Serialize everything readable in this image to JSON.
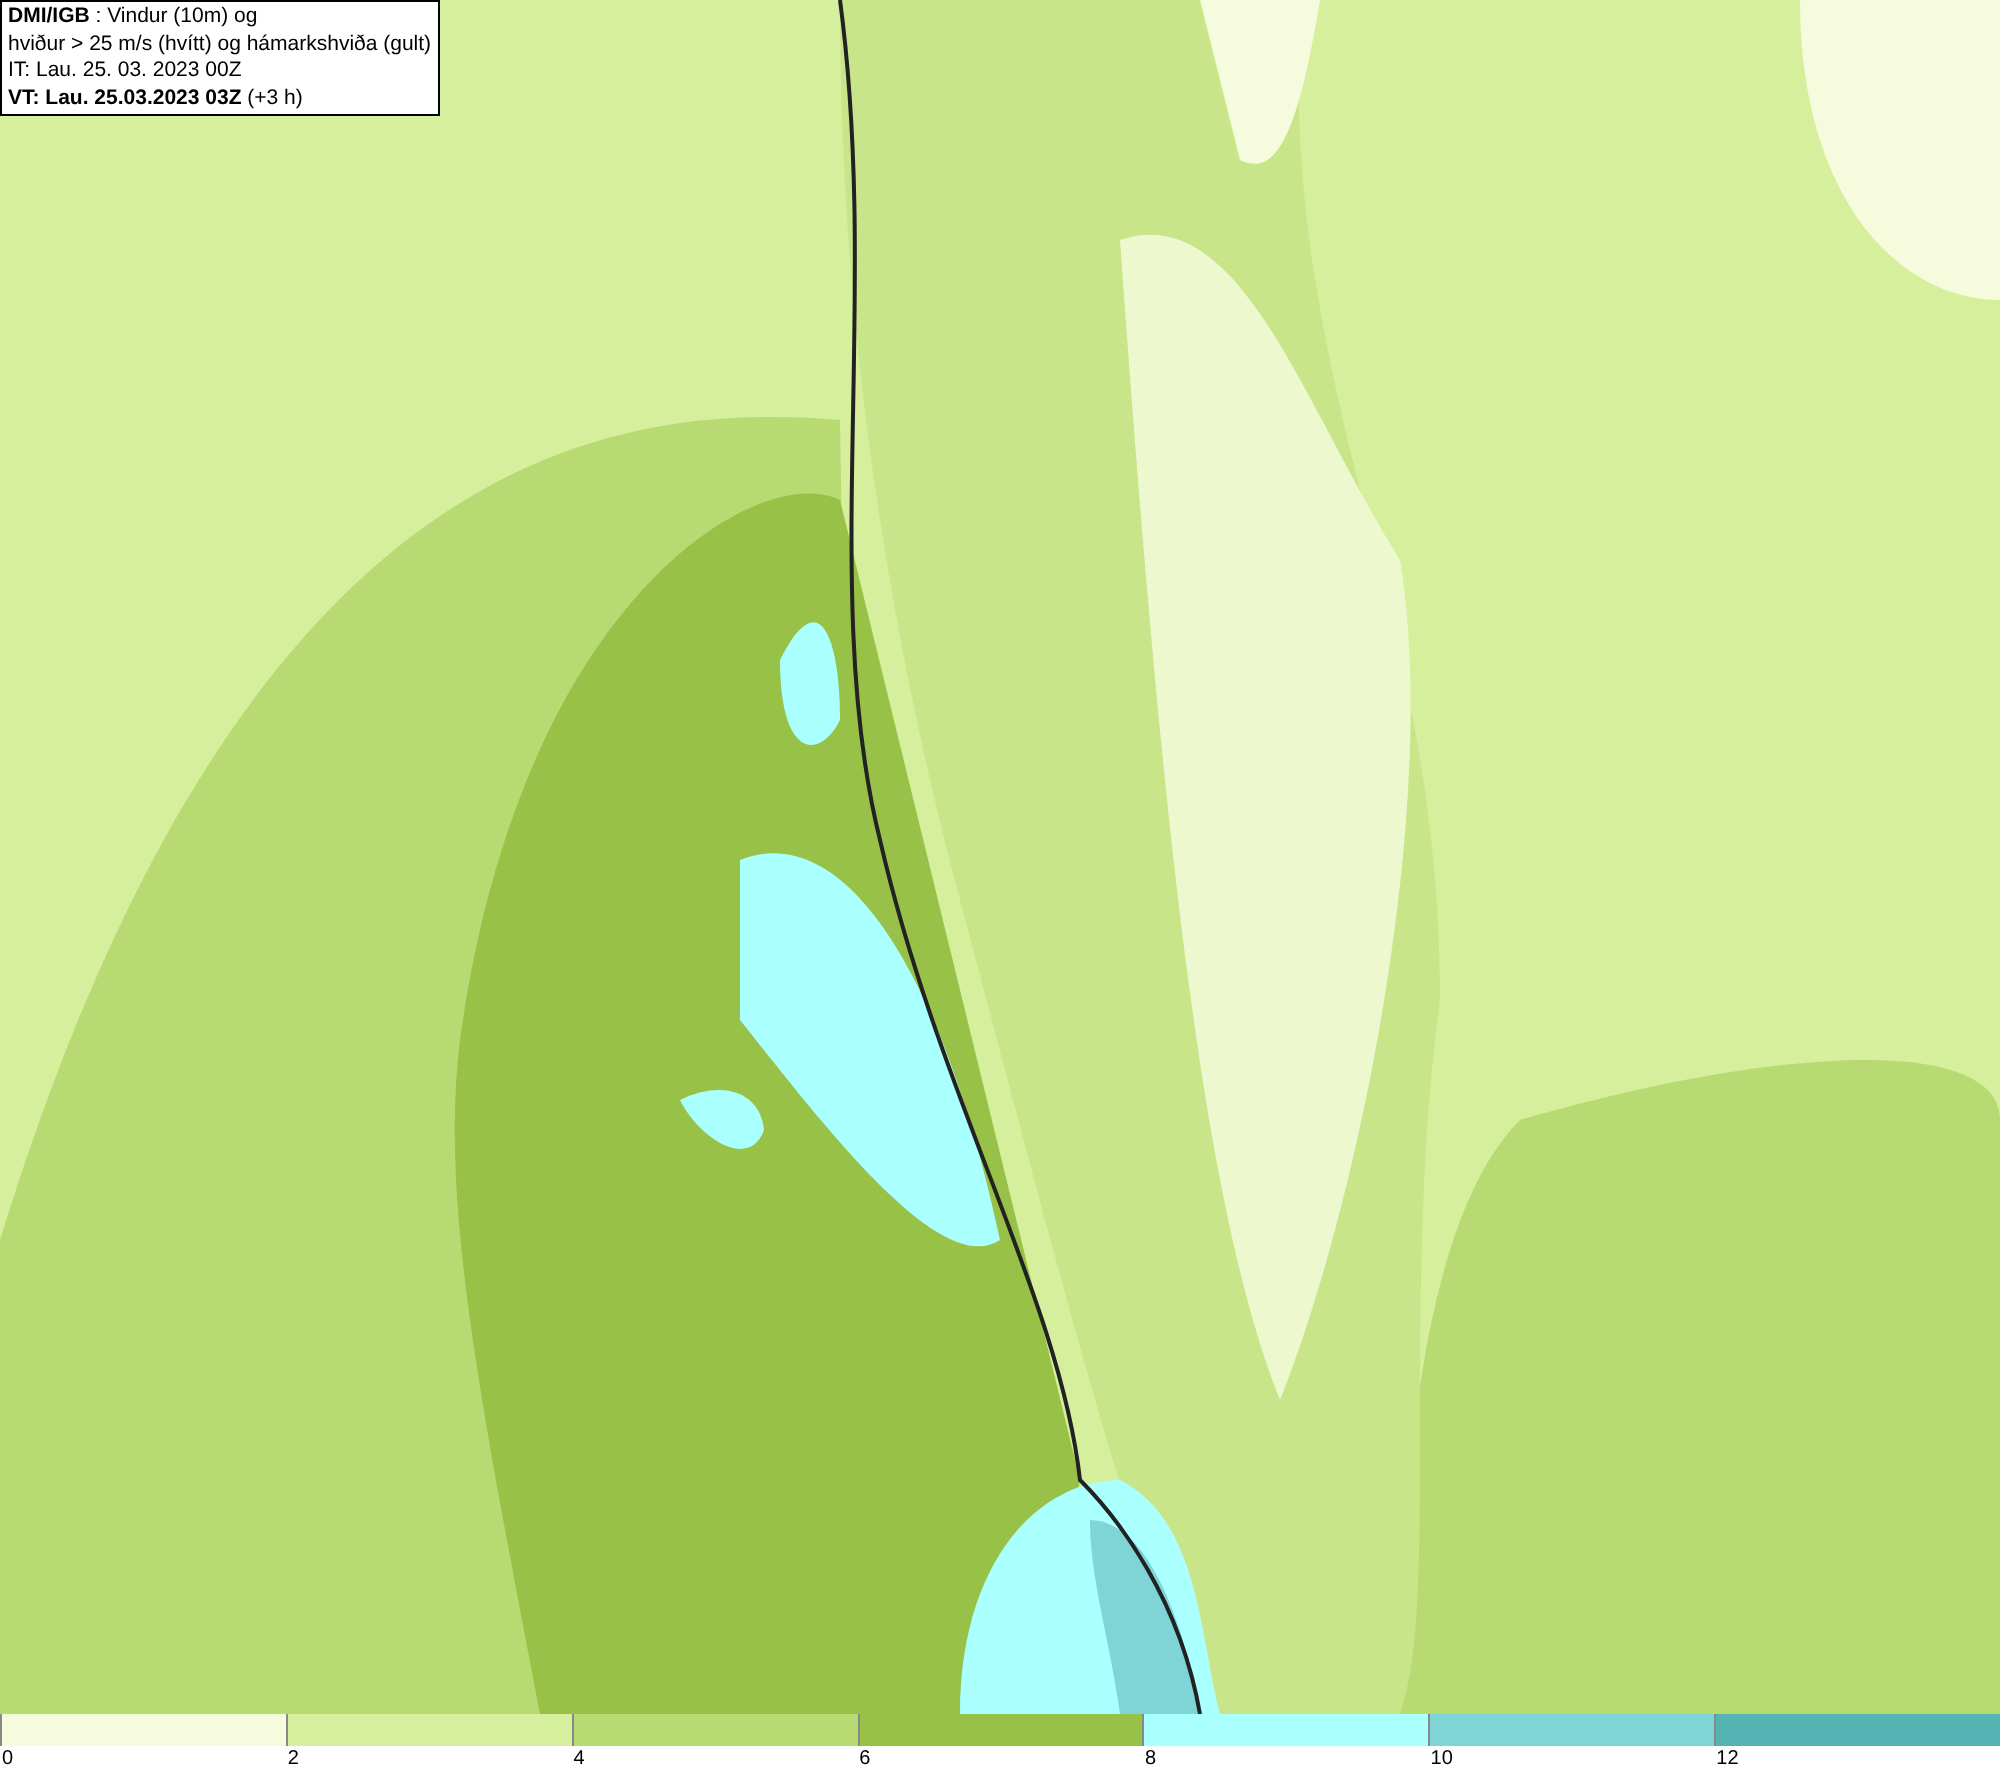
{
  "info_box": {
    "lines": [
      "**DMI/IGB** : Vindur (10m) og",
      "hviður > 25 m/s (hvítt) og hámarkshviða (gult)",
      "IT: Lau. 25. 03. 2023 00Z",
      "**VT: Lau. 25.03.2023 03Z** (+3 h)"
    ]
  },
  "legend": {
    "bins": [
      {
        "color": "#f5fbdc",
        "label": "0"
      },
      {
        "color": "#d6ef9c",
        "label": "2"
      },
      {
        "color": "#b7da72",
        "label": "4"
      },
      {
        "color": "#97c147",
        "label": "6"
      },
      {
        "color": "#aaffff",
        "label": "8"
      },
      {
        "color": "#7fd5d5",
        "label": "10"
      },
      {
        "color": "#55b3b3",
        "label": "12"
      }
    ]
  }
}
